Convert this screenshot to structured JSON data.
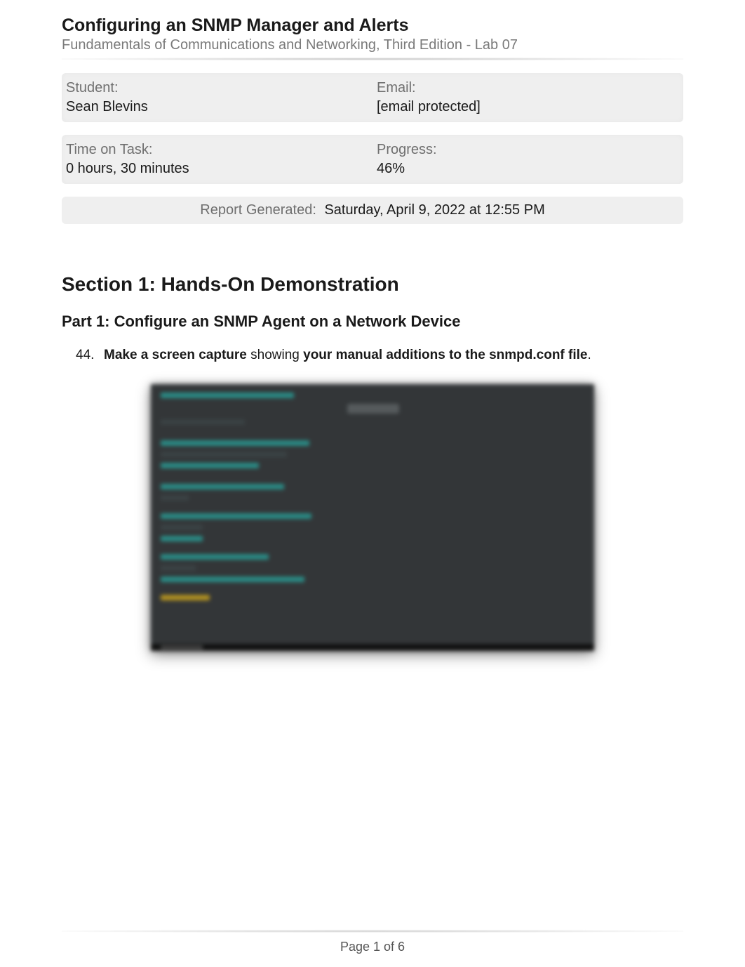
{
  "header": {
    "title": "Configuring an SNMP Manager and Alerts",
    "subtitle": "Fundamentals of Communications and Networking, Third Edition - Lab 07"
  },
  "info": {
    "student_label": "Student:",
    "student_value": "Sean Blevins",
    "email_label": "Email:",
    "email_value": "[email protected]",
    "time_label": "Time on Task:",
    "time_value": "0 hours, 30 minutes",
    "progress_label": "Progress:",
    "progress_value": "46%"
  },
  "report": {
    "label": "Report Generated:",
    "value": "Saturday, April 9, 2022 at 12:55 PM"
  },
  "section": {
    "heading": "Section 1: Hands-On Demonstration",
    "part_heading": "Part 1: Configure an SNMP Agent on a Network Device",
    "task_number": "44.",
    "task_bold1": "Make a screen capture",
    "task_mid": " showing ",
    "task_bold2": "your manual additions to the snmpd.conf file",
    "task_end": "."
  },
  "footer": {
    "page": "Page 1 of 6"
  }
}
